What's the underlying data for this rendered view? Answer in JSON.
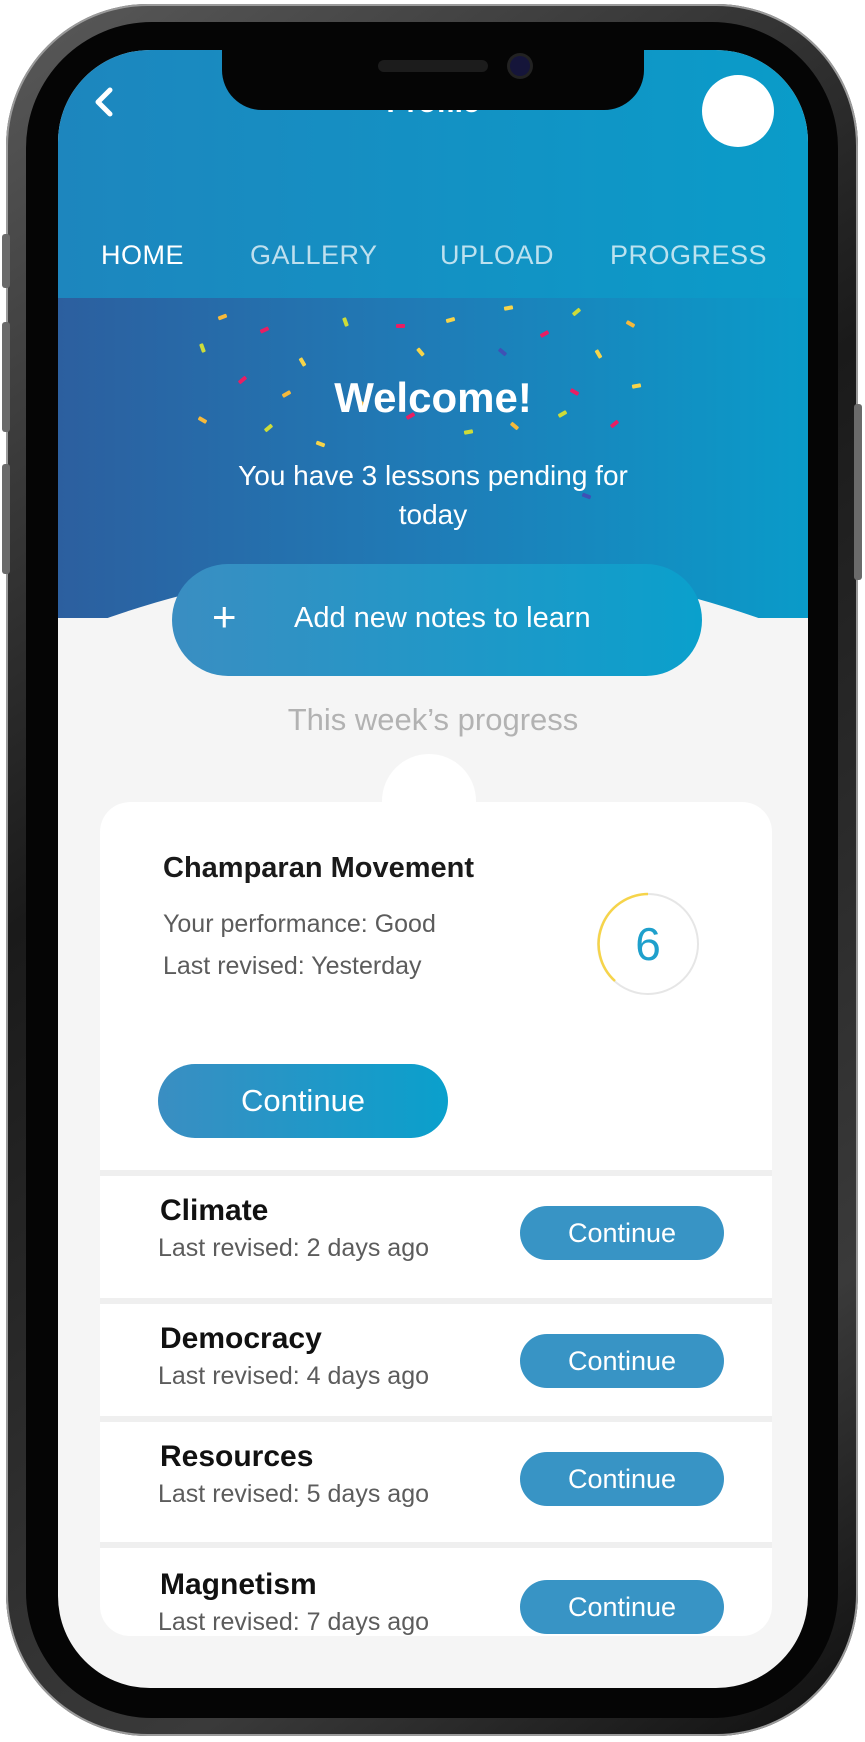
{
  "header": {
    "title": "Profile",
    "back_icon": "chevron-left-icon",
    "tabs": [
      {
        "label": "HOME",
        "active": true
      },
      {
        "label": "GALLERY",
        "active": false
      },
      {
        "label": "UPLOAD",
        "active": false
      },
      {
        "label": "PROGRESS",
        "active": false
      }
    ]
  },
  "hero": {
    "welcome": "Welcome!",
    "pending": "You have 3 lessons pending for today",
    "add_notes_icon": "plus-icon",
    "add_notes_label": "Add new notes to learn"
  },
  "progress": {
    "section_title": "This week’s progress",
    "featured": {
      "title": "Champaran Movement",
      "performance": "Your performance: Good",
      "last_revised": "Last revised: Yesterday",
      "score": "6",
      "continue_label": "Continue"
    },
    "lessons": [
      {
        "title": "Climate",
        "last_revised": "Last revised: 2 days ago",
        "continue_label": "Continue"
      },
      {
        "title": "Democracy",
        "last_revised": "Last revised: 4 days ago",
        "continue_label": "Continue"
      },
      {
        "title": "Resources",
        "last_revised": "Last revised: 5 days ago",
        "continue_label": "Continue"
      },
      {
        "title": "Magnetism",
        "last_revised": "Last revised: 7 days ago",
        "continue_label": "Continue"
      }
    ]
  },
  "colors": {
    "primary": "#0a9cc9",
    "header_start": "#2c5f9f",
    "ring_accent": "#f6d44a"
  }
}
